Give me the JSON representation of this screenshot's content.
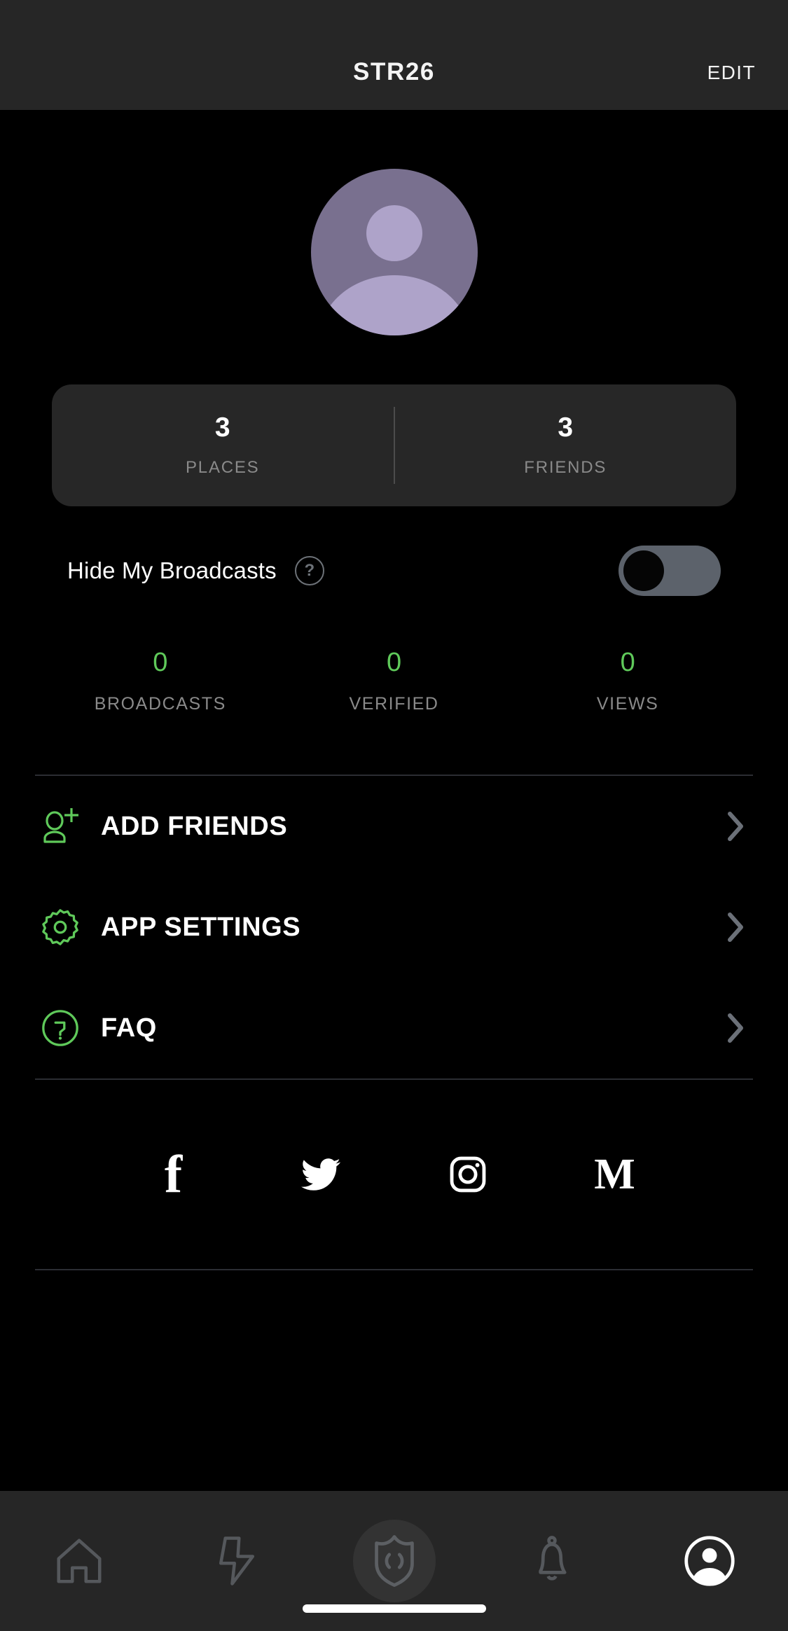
{
  "header": {
    "title": "STR26",
    "edit_label": "EDIT"
  },
  "profile": {
    "avatar_name": "default-avatar",
    "avatar_bg_color": "#79708f",
    "avatar_fg_color": "#aea3c9"
  },
  "stat_card": {
    "places": {
      "value": "3",
      "label": "PLACES"
    },
    "friends": {
      "value": "3",
      "label": "FRIENDS"
    }
  },
  "hide_broadcasts": {
    "label": "Hide My Broadcasts",
    "help_glyph": "?",
    "toggle_state": "off"
  },
  "broadcast_stats": {
    "accent_color": "#5fc95a",
    "items": [
      {
        "value": "0",
        "label": "BROADCASTS"
      },
      {
        "value": "0",
        "label": "VERIFIED"
      },
      {
        "value": "0",
        "label": "VIEWS"
      }
    ]
  },
  "menu": {
    "items": [
      {
        "label": "ADD FRIENDS",
        "icon": "add-person-icon"
      },
      {
        "label": "APP SETTINGS",
        "icon": "gear-icon"
      },
      {
        "label": "FAQ",
        "icon": "question-circle-icon"
      }
    ]
  },
  "socials": {
    "items": [
      {
        "name": "facebook-icon",
        "glyph": "f"
      },
      {
        "name": "twitter-icon",
        "glyph": ""
      },
      {
        "name": "instagram-icon",
        "glyph": ""
      },
      {
        "name": "medium-icon",
        "glyph": "M"
      }
    ]
  },
  "navbar": {
    "items": [
      {
        "name": "nav-home",
        "icon": "home-icon",
        "active": false
      },
      {
        "name": "nav-activity",
        "icon": "lightning-icon",
        "active": false
      },
      {
        "name": "nav-broadcast",
        "icon": "shield-broadcast-icon",
        "active": false
      },
      {
        "name": "nav-notifications",
        "icon": "bell-icon",
        "active": false
      },
      {
        "name": "nav-profile",
        "icon": "profile-icon",
        "active": true
      }
    ]
  },
  "colors": {
    "background": "#000000",
    "chrome": "#262626",
    "card": "#272727",
    "accent_green": "#5fc95a",
    "muted_text": "#8a8a8a",
    "divider": "#2b2d33",
    "toggle_track": "#5c626b"
  }
}
